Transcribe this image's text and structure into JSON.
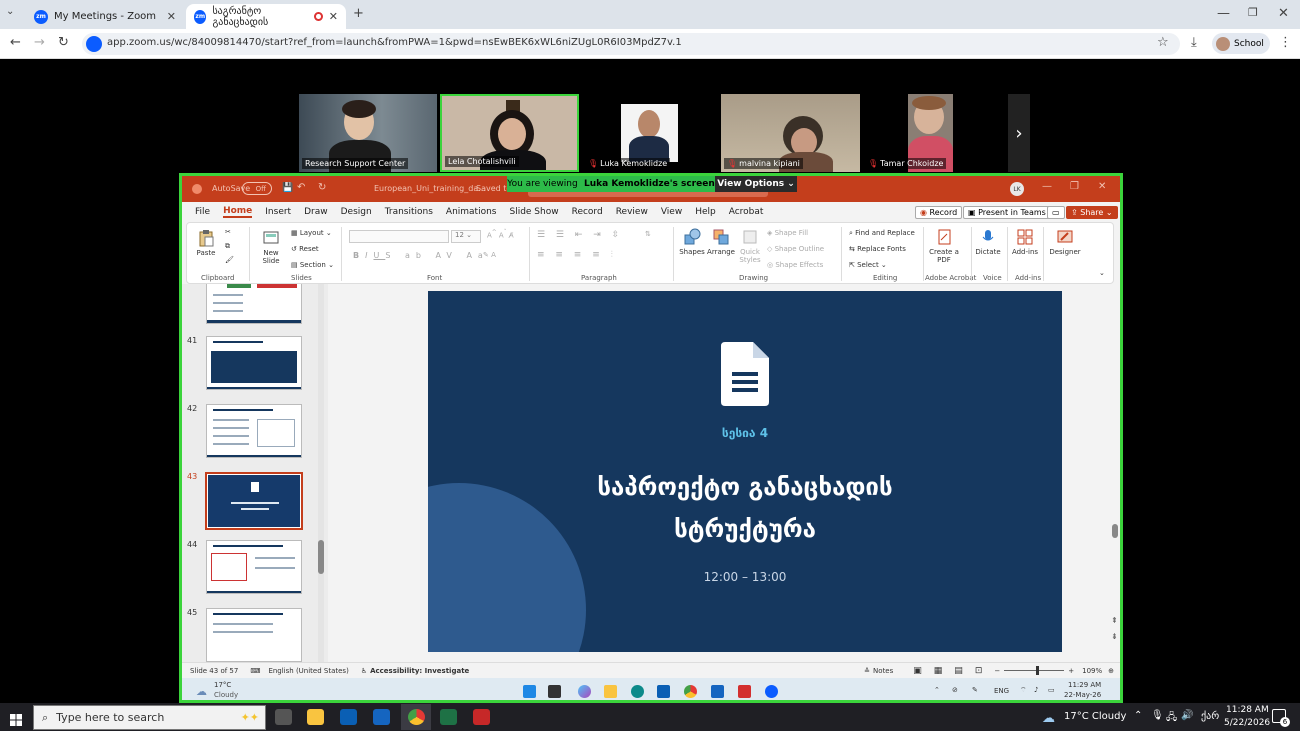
{
  "browser": {
    "tabs": [
      {
        "title": "My Meetings - Zoom"
      },
      {
        "title": "საგრანტო განაცხადის"
      }
    ],
    "url": "app.zoom.us/wc/84009814470/start?ref_from=launch&fromPWA=1&pwd=nsEwBEK6xWL6niZUgL0R6I03MpdZ7v.1",
    "profile_label": "School"
  },
  "participants": [
    {
      "name": "Research Support Center",
      "muted": false
    },
    {
      "name": "Lela Chotalishvili",
      "muted": false,
      "speaking": true
    },
    {
      "name": "Luka Kemoklidze",
      "muted": true
    },
    {
      "name": "malvina kipiani",
      "muted": true
    },
    {
      "name": "Tamar Chkoidze",
      "muted": true
    }
  ],
  "share": {
    "viewing_prefix": "You are viewing",
    "viewing_name": "Luka Kemoklidze's screen",
    "view_options": "View Options"
  },
  "powerpoint": {
    "autosave": "AutoSave",
    "autosave_state": "Off",
    "doc_title": "European_Uni_training_da...",
    "saved_state": "Saved to",
    "user_initials": "LK",
    "tabs": [
      "File",
      "Home",
      "Insert",
      "Draw",
      "Design",
      "Transitions",
      "Animations",
      "Slide Show",
      "Record",
      "Review",
      "View",
      "Help",
      "Acrobat"
    ],
    "active_tab": "Home",
    "record_btn": "Record",
    "present_teams": "Present in Teams",
    "share_btn": "Share",
    "ribbon": {
      "paste": "Paste",
      "clipboard": "Clipboard",
      "new_slide": "New Slide",
      "layout": "Layout",
      "reset": "Reset",
      "section": "Section",
      "slides": "Slides",
      "font_size": "12",
      "font": "Font",
      "paragraph": "Paragraph",
      "shapes": "Shapes",
      "arrange": "Arrange",
      "quick_styles": "Quick Styles",
      "shape_fill": "Shape Fill",
      "shape_outline": "Shape Outline",
      "shape_effects": "Shape Effects",
      "drawing": "Drawing",
      "find_replace": "Find and Replace",
      "replace_fonts": "Replace Fonts",
      "select": "Select",
      "editing": "Editing",
      "create_pdf": "Create a PDF",
      "adobe_acrobat": "Adobe Acrobat",
      "dictate": "Dictate",
      "voice": "Voice",
      "add_ins": "Add-ins",
      "add_ins_group": "Add-ins",
      "designer": "Designer"
    },
    "thumbnails": [
      {
        "num": "41"
      },
      {
        "num": "42"
      },
      {
        "num": "43",
        "selected": true
      },
      {
        "num": "44"
      },
      {
        "num": "45"
      }
    ],
    "slide": {
      "session": "სესია 4",
      "title_line1": "საპროექტო განაცხადის",
      "title_line2": "სტრუქტურა",
      "time": "12:00 – 13:00"
    },
    "status": {
      "slide_info": "Slide 43 of 57",
      "language": "English (United States)",
      "accessibility": "Accessibility: Investigate",
      "notes": "Notes",
      "zoom": "109%"
    }
  },
  "remote_taskbar": {
    "weather_temp": "17°C",
    "weather_desc": "Cloudy",
    "lang": "ENG",
    "time": "11:29 AM",
    "date": "22-May-26"
  },
  "taskbar": {
    "search_placeholder": "Type here to search",
    "weather": "17°C  Cloudy",
    "lang": "ქარ",
    "time": "11:28 AM",
    "date": "5/22/2026",
    "notif_count": "6"
  },
  "colors": {
    "ppt_accent": "#c43e1c",
    "active_speaker": "#3bd43b",
    "slide_bg": "#15375e",
    "session_label": "#5ec1e8"
  }
}
